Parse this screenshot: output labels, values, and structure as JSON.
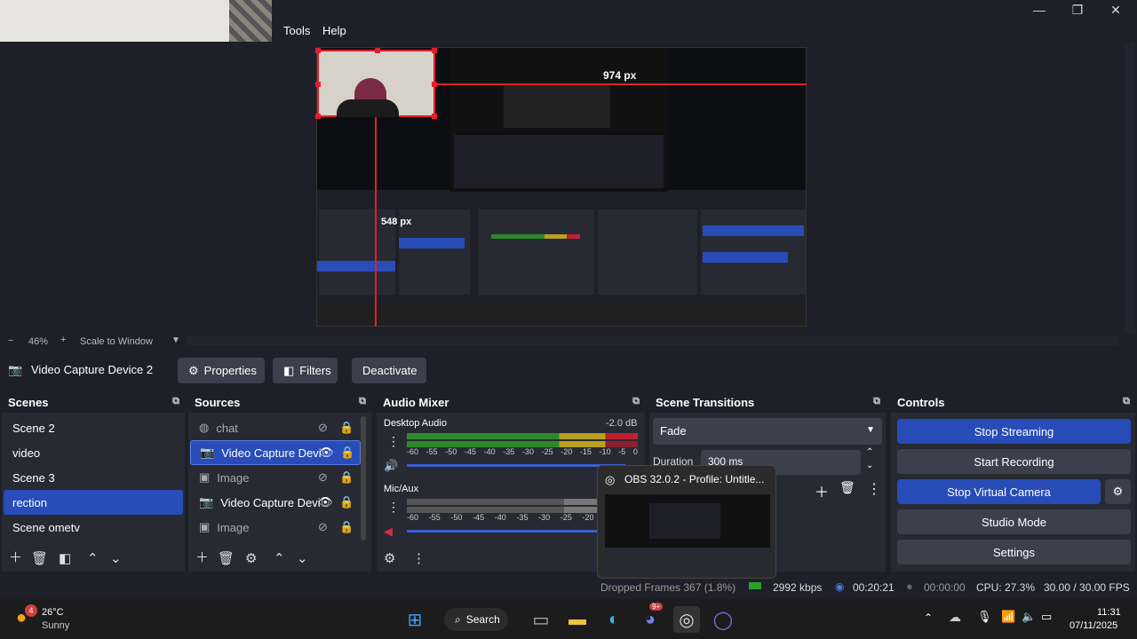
{
  "menubar": {
    "tools": "Tools",
    "help": "Help"
  },
  "window_controls": {
    "minimize": "—",
    "maximize": "❐",
    "close": "✕"
  },
  "canvas_overlay": {
    "width_label": "974 px",
    "height_label": "548 px"
  },
  "zoom": {
    "level": "46%",
    "mode": "Scale to Window"
  },
  "source_toolbar": {
    "source_name": "Video Capture Device 2",
    "properties": "Properties",
    "filters": "Filters",
    "deactivate": "Deactivate"
  },
  "scenes": {
    "title": "Scenes",
    "items": [
      "Scene 2",
      "video",
      "Scene 3",
      "rection",
      "Scene ometv"
    ],
    "selected_index": 3
  },
  "sources": {
    "title": "Sources",
    "items": [
      "chat",
      "Video Capture Devi",
      "Image",
      "Video Capture Devi",
      "Image"
    ],
    "selected_index": 1
  },
  "audio_mixer": {
    "title": "Audio Mixer",
    "channels": [
      {
        "name": "Desktop Audio",
        "db": "-2.0 dB"
      },
      {
        "name": "Mic/Aux",
        "db": ""
      }
    ],
    "scale": [
      "-60",
      "-55",
      "-50",
      "-45",
      "-40",
      "-35",
      "-30",
      "-25",
      "-20",
      "-15",
      "-10",
      "-5",
      "0"
    ]
  },
  "transitions": {
    "title": "Scene Transitions",
    "selected": "Fade",
    "duration_label": "Duration",
    "duration_value": "300 ms"
  },
  "controls": {
    "title": "Controls",
    "stop_streaming": "Stop Streaming",
    "start_recording": "Start Recording",
    "stop_virtual_camera": "Stop Virtual Camera",
    "studio_mode": "Studio Mode",
    "settings": "Settings"
  },
  "taskbar_popup": {
    "title": "OBS 32.0.2 - Profile: Untitle..."
  },
  "statusbar": {
    "dropped_frames": "Dropped Frames 367 (1.8%)",
    "bitrate": "2992 kbps",
    "stream_time": "00:20:21",
    "rec_time": "00:00:00",
    "cpu": "CPU: 27.3%",
    "fps": "30.00 / 30.00 FPS"
  },
  "taskbar": {
    "weather_temp": "26°C",
    "weather_desc": "Sunny",
    "weather_badge": "4",
    "search": "Search",
    "discord_badge": "9+",
    "time": "11:31",
    "date": "07/11/2025"
  },
  "colors": {
    "accent": "#284cb8",
    "panel": "#272a33",
    "bg": "#1e1f29",
    "red_box": "#e0202a"
  }
}
